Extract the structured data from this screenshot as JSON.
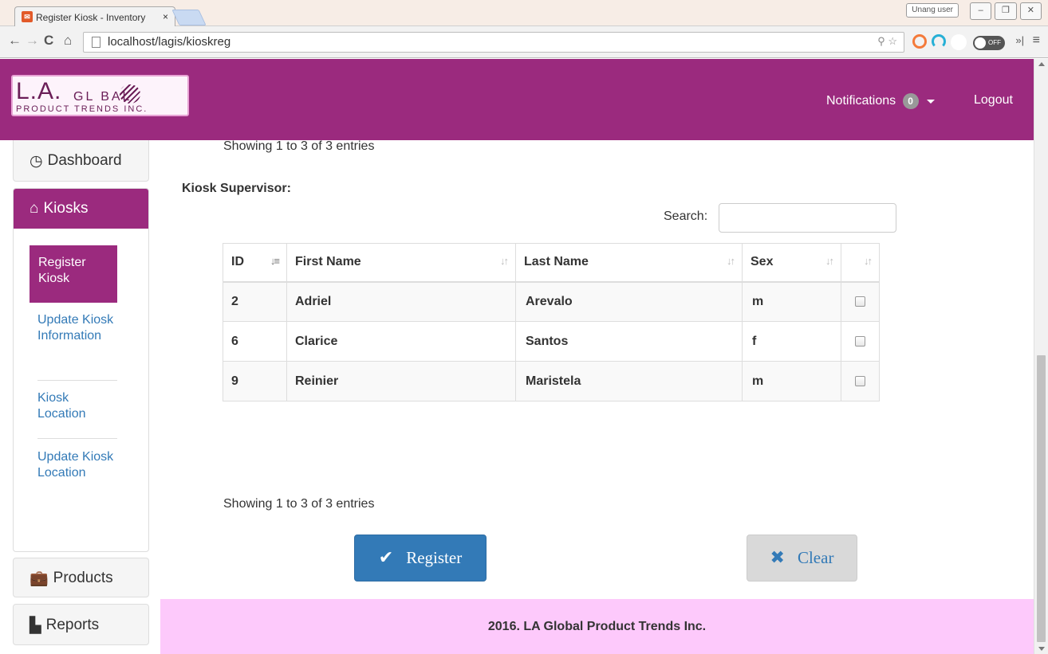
{
  "browser": {
    "tab_title": "Register Kiosk - Inventory",
    "tab_close": "×",
    "url": "localhost/lagis/kioskreg",
    "user_badge": "Unang user",
    "toggle_label": "OFF"
  },
  "header": {
    "logo_line1": "L.A.",
    "logo_line2": "GL  BAL",
    "logo_line3": "PRODUCT TRENDS INC.",
    "notifications_label": "Notifications",
    "notifications_count": "0",
    "logout_label": "Logout"
  },
  "sidebar": {
    "dashboard": "Dashboard",
    "kiosks": "Kiosks",
    "kiosk_items": [
      {
        "label": "Register Kiosk",
        "active": true
      },
      {
        "label": "Update Kiosk Information",
        "active": false
      },
      {
        "label": "Kiosk Location",
        "active": false
      },
      {
        "label": "Update Kiosk Location",
        "active": false
      }
    ],
    "products": "Products",
    "reports": "Reports"
  },
  "main": {
    "top_info": "Showing 1 to 3 of 3 entries",
    "supervisor_label": "Kiosk Supervisor:",
    "search_label": "Search:",
    "search_value": "",
    "table": {
      "columns": [
        "ID",
        "First Name",
        "Last Name",
        "Sex",
        ""
      ],
      "rows": [
        {
          "id": "2",
          "first": "Adriel",
          "last": "Arevalo",
          "sex": "m"
        },
        {
          "id": "6",
          "first": "Clarice",
          "last": "Santos",
          "sex": "f"
        },
        {
          "id": "9",
          "first": "Reinier",
          "last": "Maristela",
          "sex": "m"
        }
      ]
    },
    "bottom_info": "Showing 1 to 3 of 3 entries",
    "register_label": "Register",
    "clear_label": "Clear"
  },
  "footer": {
    "text": "2016. LA Global Product Trends Inc."
  },
  "colors": {
    "brand": "#9b2a7e",
    "footer_bg": "#fdc9fb",
    "primary": "#337ab7"
  }
}
